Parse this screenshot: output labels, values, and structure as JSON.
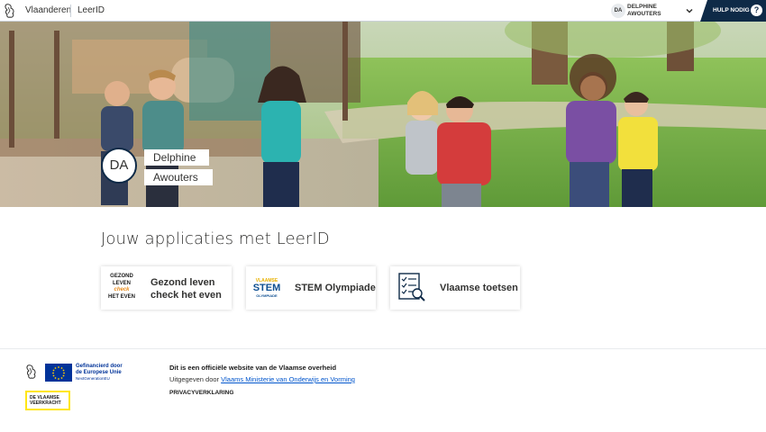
{
  "header": {
    "brand": "Vlaanderen",
    "app_name": "LeerID",
    "user_initials": "DA",
    "user_name_line1": "DELPHINE",
    "user_name_line2": "AWOUTERS",
    "help_label": "HULP NODIG",
    "help_icon_text": "?"
  },
  "hero": {
    "avatar_initials": "DA",
    "first_name": "Delphine",
    "last_name": "Awouters"
  },
  "apps": {
    "title": "Jouw applicaties met LeerID",
    "items": [
      {
        "label_line1": "Gezond leven",
        "label_line2": "check het even",
        "logo_l1": "GEZOND",
        "logo_l2": "LEVEN",
        "logo_l3": "check",
        "logo_l4": "HET EVEN"
      },
      {
        "label": "STEM Olympiade",
        "logo_l1": "VLAAMSE",
        "logo_l2": "STEM",
        "logo_l3": "OLYMPIADE"
      },
      {
        "label": "Vlaamse toetsen"
      }
    ]
  },
  "footer": {
    "eu_text": "Gefinancierd door de Europese Unie",
    "eu_sub": "NextGenerationEU",
    "vk_text": "DE VLAAMSE VEERKRACHT",
    "official_text": "Dit is een officiële website van de Vlaamse overheid",
    "published_by": "Uitgegeven door",
    "ministry_link": "Vlaams Ministerie van Onderwijs en Vorming",
    "privacy": "PRIVACYVERKLARING"
  },
  "colors": {
    "navy": "#0e2a47",
    "link": "#0055cc",
    "eu_blue": "#003399",
    "vk_yellow": "#ffe615"
  }
}
